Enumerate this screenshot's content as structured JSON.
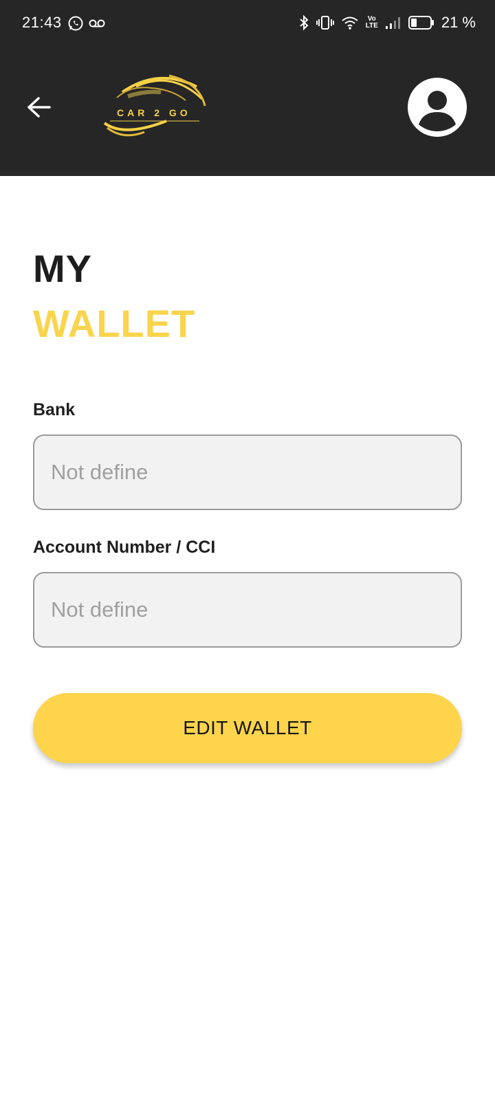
{
  "status_bar": {
    "time": "21:43",
    "battery_text": "21 %",
    "lte_top": "Vo",
    "lte_bottom": "LTE"
  },
  "header": {
    "logo_text": "CAR 2 GO",
    "background_color": "#262626",
    "accent_color": "#F9D44D"
  },
  "page": {
    "title_line1": "MY",
    "title_line2": "WALLET"
  },
  "form": {
    "bank_label": "Bank",
    "bank_placeholder": "Not define",
    "account_label": "Account Number / CCI",
    "account_placeholder": "Not define"
  },
  "actions": {
    "edit_wallet_label": "EDIT WALLET"
  }
}
